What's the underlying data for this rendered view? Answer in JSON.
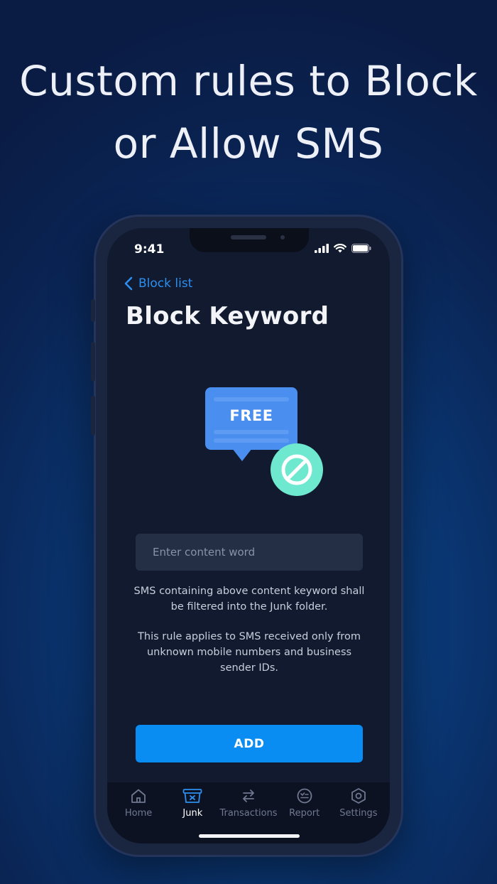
{
  "headline": {
    "line1": "Custom rules to Block",
    "line2": "or Allow SMS"
  },
  "status_bar": {
    "time": "9:41",
    "icons": [
      "signal-icon",
      "wifi-icon",
      "battery-icon"
    ]
  },
  "nav": {
    "back_label": "Block list",
    "title": "Block Keyword"
  },
  "illustration": {
    "bubble_text": "FREE",
    "icons": [
      "chat-bubble-icon",
      "block-icon"
    ]
  },
  "form": {
    "input_placeholder": "Enter content word",
    "input_value": "",
    "description_1_line1": "SMS containing above content keyword shall",
    "description_1_line2": "be filtered into the Junk folder.",
    "description_2_line1": "This rule applies to SMS received only from",
    "description_2_line2": "unknown mobile numbers and business",
    "description_2_line3": "sender IDs.",
    "add_label": "ADD"
  },
  "tabbar": {
    "items": [
      {
        "label": "Home",
        "icon": "home-icon",
        "active": false
      },
      {
        "label": "Junk",
        "icon": "junk-icon",
        "active": true
      },
      {
        "label": "Transactions",
        "icon": "transfer-icon",
        "active": false
      },
      {
        "label": "Report",
        "icon": "report-icon",
        "active": false
      },
      {
        "label": "Settings",
        "icon": "settings-icon",
        "active": false
      }
    ]
  },
  "colors": {
    "accent": "#0a8df3",
    "link": "#2d8ff0",
    "bubble": "#4a8ff0",
    "block_badge": "#6ee8cf",
    "screen_bg": "#111a2e"
  }
}
